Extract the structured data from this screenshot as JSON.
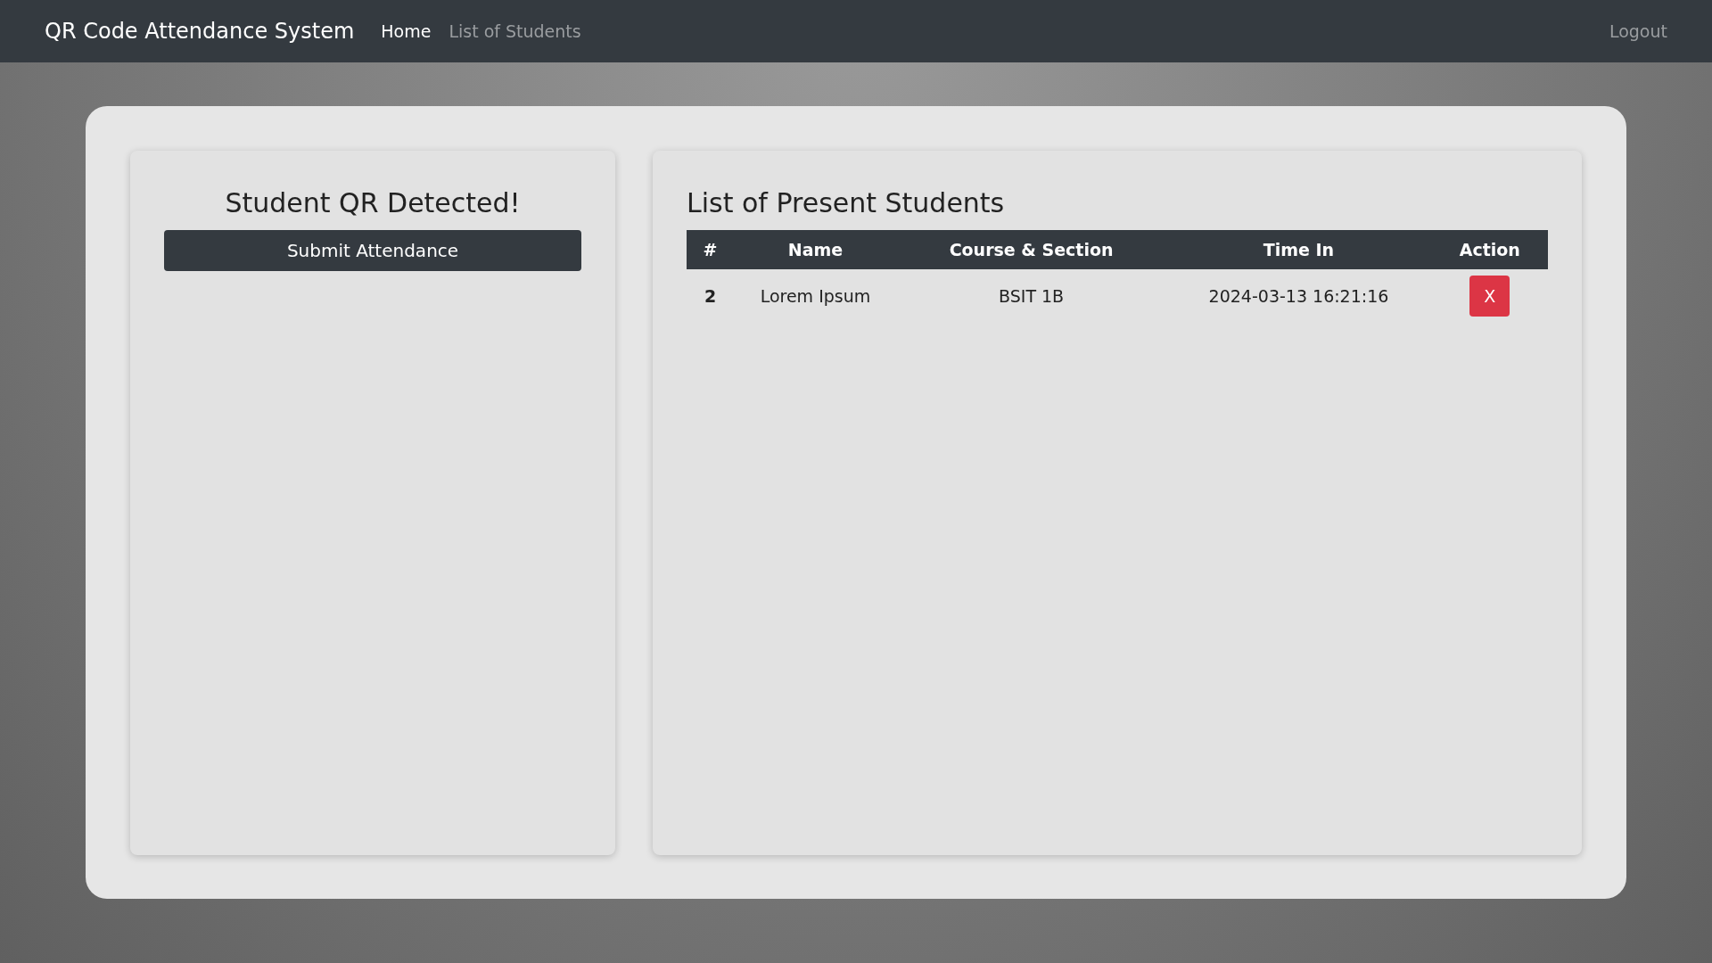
{
  "navbar": {
    "brand": "QR Code Attendance System",
    "links": [
      {
        "label": "Home",
        "selected": true
      },
      {
        "label": "List of Students",
        "selected": false
      }
    ],
    "logout": "Logout"
  },
  "scanner_panel": {
    "title": "Student QR Detected!",
    "submit_button": "Submit Attendance"
  },
  "attendance_panel": {
    "title": "List of Present Students",
    "table": {
      "columns": [
        "#",
        "Name",
        "Course & Section",
        "Time In",
        "Action"
      ],
      "rows": [
        {
          "number": "2",
          "name": "Lorem Ipsum",
          "course_section": "BSIT 1B",
          "time_in": "2024-03-13 16:21:16",
          "action": "X"
        }
      ]
    }
  }
}
